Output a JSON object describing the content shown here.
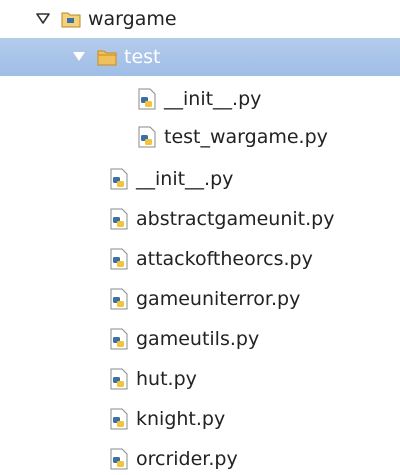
{
  "tree": {
    "root": {
      "label": "wargame",
      "icon": "package-folder-icon",
      "expanded": true
    },
    "test_folder": {
      "label": "test",
      "icon": "folder-icon",
      "expanded": true,
      "selected": true
    },
    "test_children": [
      {
        "label": "__init__.py",
        "icon": "python-file-icon"
      },
      {
        "label": "test_wargame.py",
        "icon": "python-file-icon"
      }
    ],
    "files": [
      {
        "label": "__init__.py",
        "icon": "python-file-icon"
      },
      {
        "label": "abstractgameunit.py",
        "icon": "python-file-icon"
      },
      {
        "label": "attackoftheorcs.py",
        "icon": "python-file-icon"
      },
      {
        "label": "gameuniterror.py",
        "icon": "python-file-icon"
      },
      {
        "label": "gameutils.py",
        "icon": "python-file-icon"
      },
      {
        "label": "hut.py",
        "icon": "python-file-icon"
      },
      {
        "label": "knight.py",
        "icon": "python-file-icon"
      },
      {
        "label": "orcrider.py",
        "icon": "python-file-icon"
      }
    ]
  },
  "colors": {
    "selection": "#a9c4ea",
    "folder": "#e8b04a",
    "python_blue": "#3b6fa6",
    "python_yellow": "#f2c43a"
  }
}
